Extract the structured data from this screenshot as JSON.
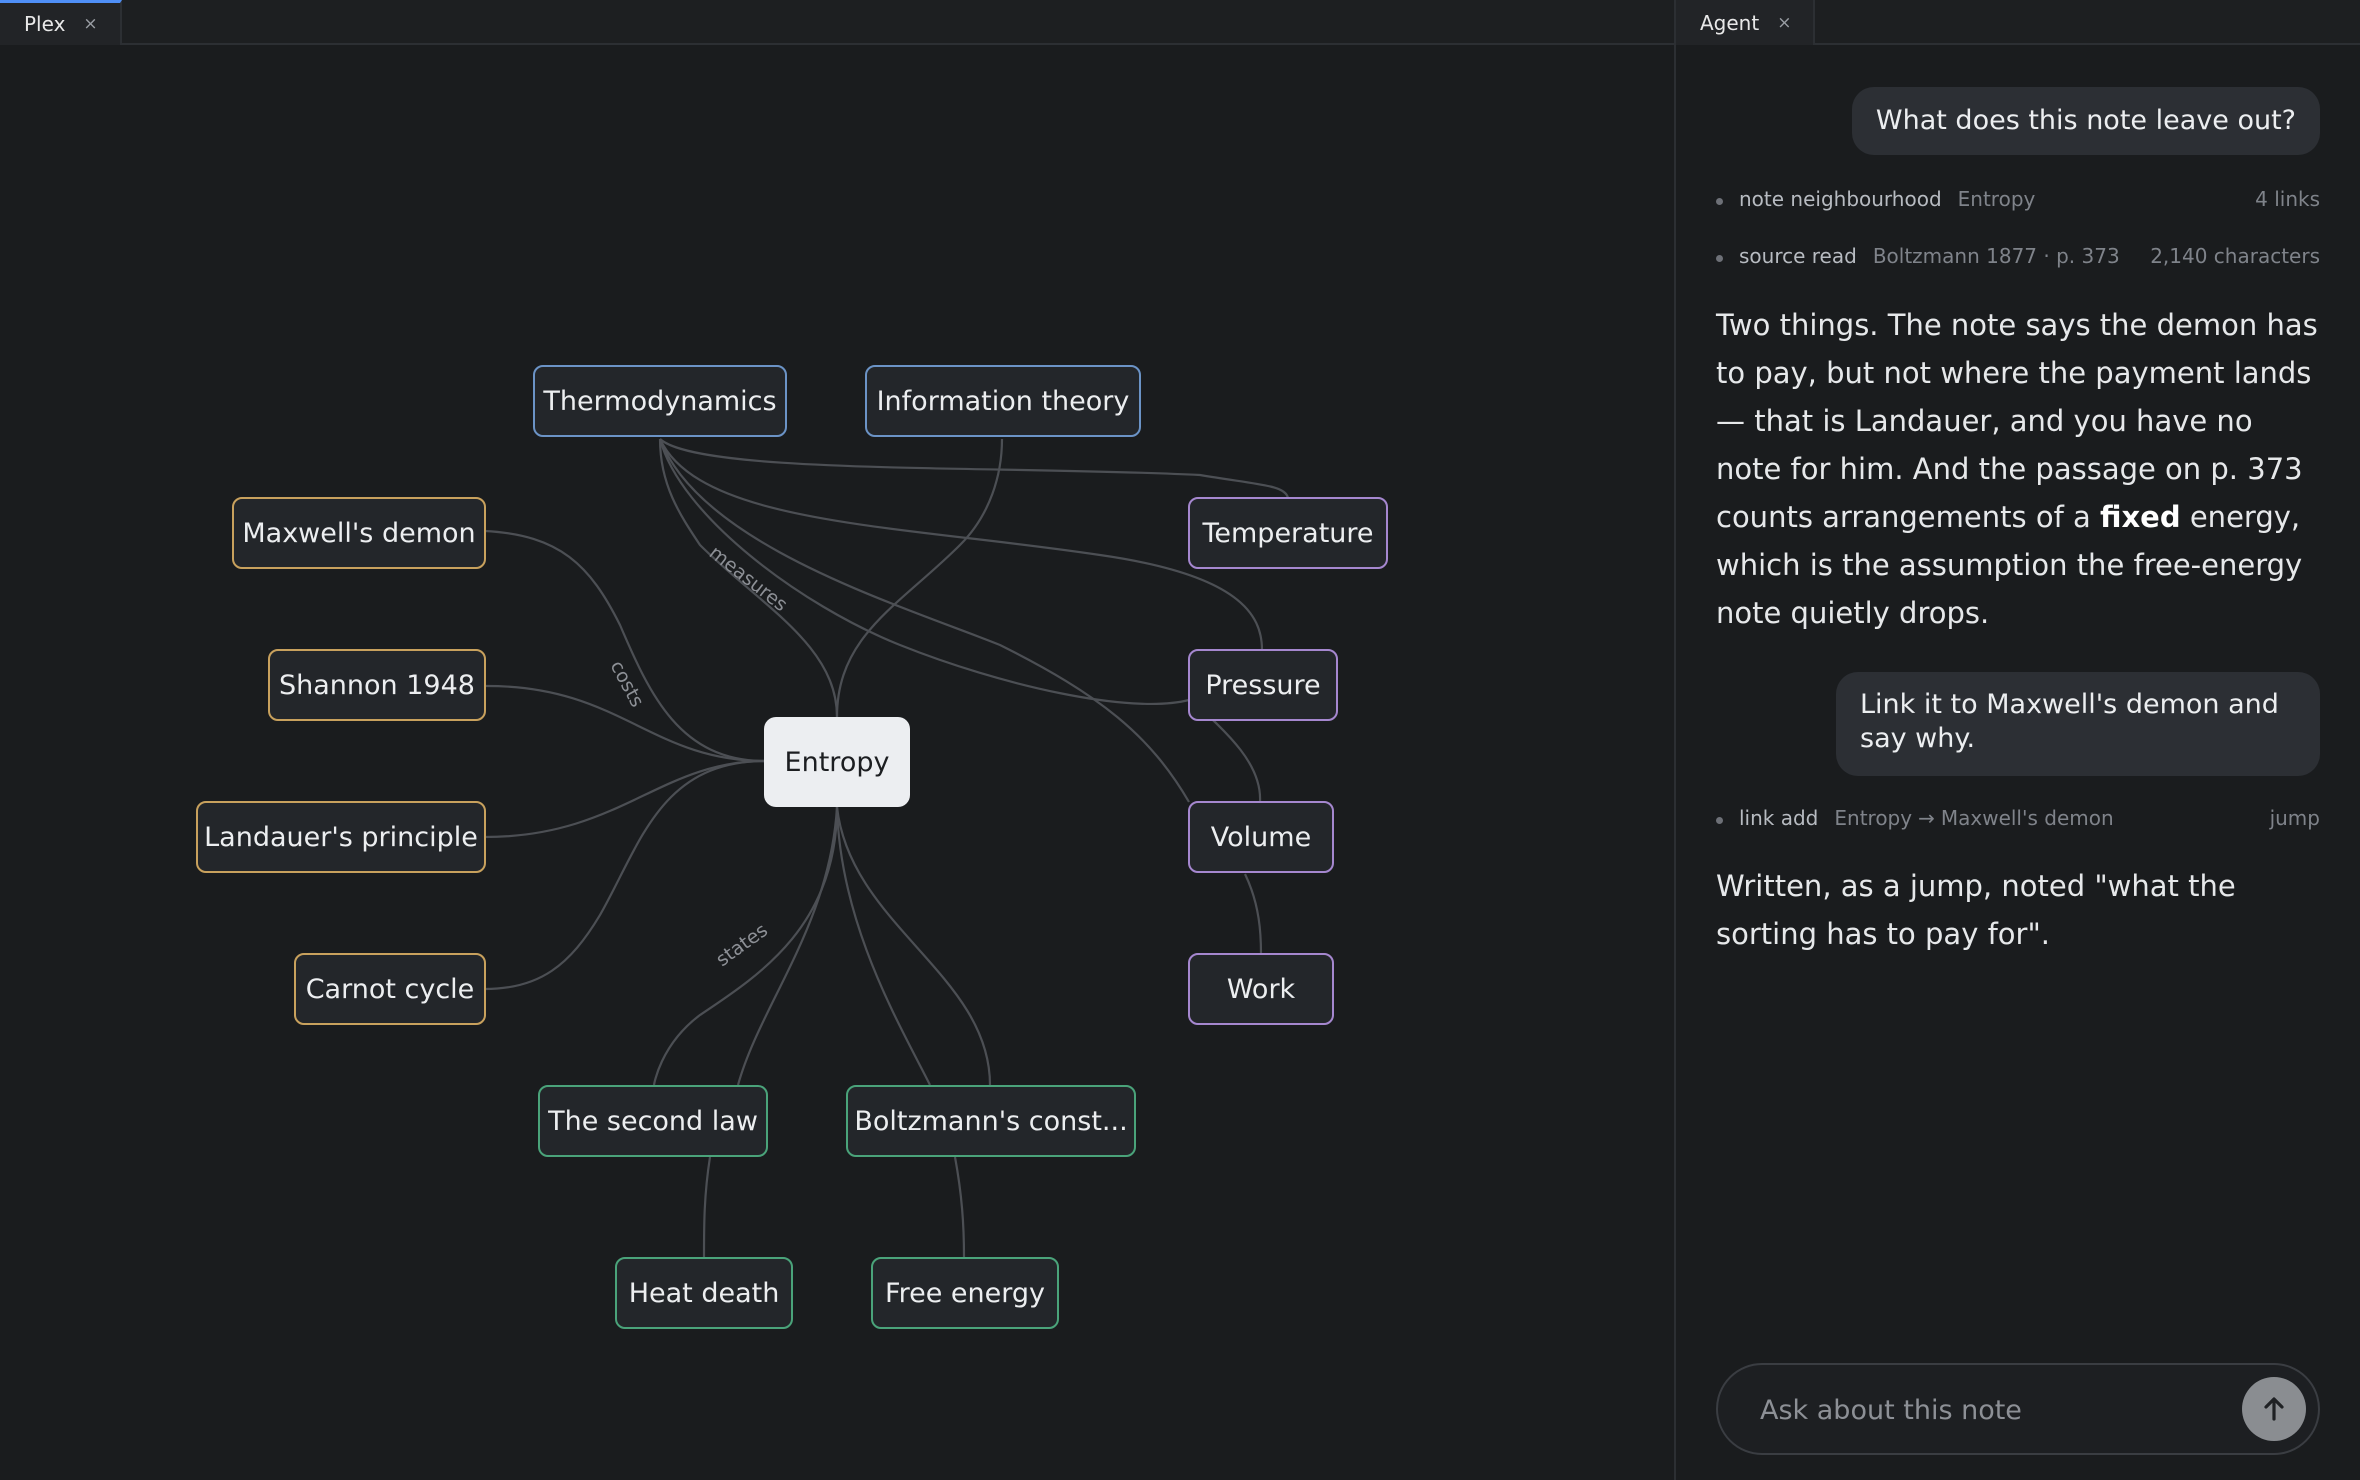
{
  "tabs": {
    "left": {
      "label": "Plex",
      "close": "×"
    },
    "right": {
      "label": "Agent",
      "close": "×"
    }
  },
  "graph": {
    "center": "Entropy",
    "nodes": {
      "thermodynamics": "Thermodynamics",
      "information_theory": "Information theory",
      "maxwells_demon": "Maxwell's demon",
      "shannon": "Shannon 1948",
      "landauer": "Landauer's principle",
      "carnot": "Carnot cycle",
      "temperature": "Temperature",
      "pressure": "Pressure",
      "volume": "Volume",
      "work": "Work",
      "second_law": "The second law",
      "boltzmann": "Boltzmann's const...",
      "heat_death": "Heat death",
      "free_energy": "Free energy"
    },
    "edge_labels": {
      "measures": "measures",
      "costs": "costs",
      "states": "states"
    },
    "colors": {
      "blue": "#6b93c6",
      "gold": "#c8a15d",
      "violet": "#a587cf",
      "green": "#4aa37a"
    }
  },
  "agent": {
    "messages": {
      "user_1": "What does this note leave out?",
      "user_2": "Link it to Maxwell's demon and say why."
    },
    "tools": {
      "neighbourhood": {
        "name": "note neighbourhood",
        "arg": "Entropy",
        "meta": "4 links"
      },
      "source": {
        "name": "source read",
        "arg": "Boltzmann 1877 · p. 373",
        "meta": "2,140 characters"
      },
      "link": {
        "name": "link add",
        "from": "Entropy",
        "arrow": "→",
        "to": "Maxwell's demon",
        "meta": "jump"
      }
    },
    "reply_1": {
      "before": "Two things. The note says the demon has to pay, but not where the payment lands — that is Landauer, and you have no note for him. And the passage on p. 373 counts arrangements of a ",
      "bold": "fixed",
      "after": " energy, which is the assumption the free-energy note quietly drops."
    },
    "reply_2": "Written, as a jump, noted \"what the sorting has to pay for\".",
    "composer": {
      "placeholder": "Ask about this note"
    }
  }
}
